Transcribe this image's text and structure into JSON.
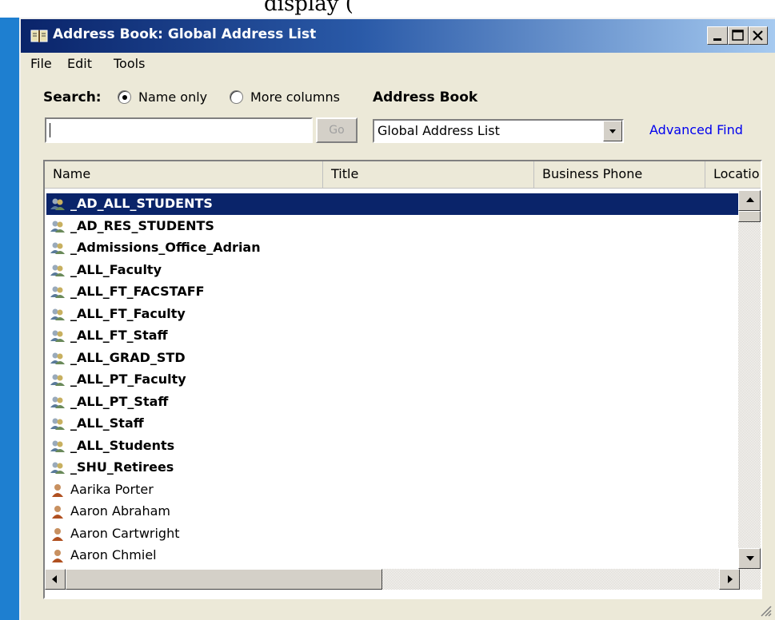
{
  "background": {
    "caption_fragment": "display (",
    "desktop_color": "#1e7fd0"
  },
  "window": {
    "title": "Address Book: Global Address List",
    "title_icon": "address-book-icon",
    "controls": {
      "minimize_icon": "minimize-icon",
      "maximize_icon": "maximize-icon",
      "close_icon": "close-icon"
    }
  },
  "menu": {
    "items": [
      {
        "label": "File"
      },
      {
        "label": "Edit"
      },
      {
        "label": "Tools"
      }
    ]
  },
  "search": {
    "label": "Search:",
    "option_name_only": "Name only",
    "option_more_columns": "More columns",
    "selected_option": "Name only",
    "input_value": "",
    "go_label": "Go"
  },
  "address_book": {
    "label": "Address Book",
    "selected": "Global Address List",
    "advanced_find": "Advanced Find"
  },
  "list": {
    "columns": [
      {
        "label": "Name"
      },
      {
        "label": "Title"
      },
      {
        "label": "Business Phone"
      },
      {
        "label": "Locatio"
      }
    ],
    "rows": [
      {
        "name": "_AD_ALL_STUDENTS",
        "type": "group",
        "icon": "group-icon",
        "selected": true
      },
      {
        "name": "_AD_RES_STUDENTS",
        "type": "group",
        "icon": "group-icon"
      },
      {
        "name": "_Admissions_Office_Adrian",
        "type": "group",
        "icon": "group-icon"
      },
      {
        "name": "_ALL_Faculty",
        "type": "group",
        "icon": "group-icon"
      },
      {
        "name": "_ALL_FT_FACSTAFF",
        "type": "group",
        "icon": "group-icon"
      },
      {
        "name": "_ALL_FT_Faculty",
        "type": "group",
        "icon": "group-icon"
      },
      {
        "name": "_ALL_FT_Staff",
        "type": "group",
        "icon": "group-icon"
      },
      {
        "name": "_ALL_GRAD_STD",
        "type": "group",
        "icon": "group-icon"
      },
      {
        "name": "_ALL_PT_Faculty",
        "type": "group",
        "icon": "group-icon"
      },
      {
        "name": "_ALL_PT_Staff",
        "type": "group",
        "icon": "group-icon"
      },
      {
        "name": "_ALL_Staff",
        "type": "group",
        "icon": "group-icon"
      },
      {
        "name": "_ALL_Students",
        "type": "group",
        "icon": "group-icon"
      },
      {
        "name": "_SHU_Retirees",
        "type": "group",
        "icon": "group-icon"
      },
      {
        "name": "Aarika Porter",
        "type": "person",
        "icon": "person-icon"
      },
      {
        "name": "Aaron Abraham",
        "type": "person",
        "icon": "person-icon"
      },
      {
        "name": "Aaron Cartwright",
        "type": "person",
        "icon": "person-icon"
      },
      {
        "name": "Aaron Chmiel",
        "type": "person",
        "icon": "person-icon"
      }
    ]
  },
  "colors": {
    "selection": "#0a246a",
    "link": "#0000ee",
    "window_face": "#ece9d8"
  }
}
